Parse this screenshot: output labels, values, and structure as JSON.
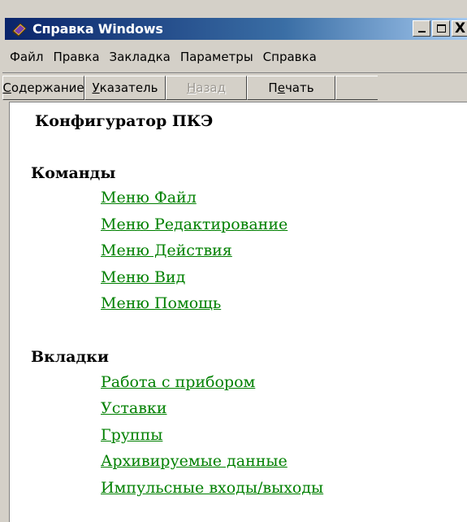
{
  "window": {
    "title": "Справка Windows",
    "icon": "help-book-icon",
    "buttons": {
      "minimize": "_",
      "maximize": "□",
      "close": "X"
    }
  },
  "menu": [
    "Файл",
    "Правка",
    "Закладка",
    "Параметры",
    "Справка"
  ],
  "toolbar": {
    "contents": {
      "accel": "С",
      "rest": "одержание"
    },
    "index": {
      "accel": "У",
      "rest": "казатель"
    },
    "back": {
      "accel": "Н",
      "rest": "азад",
      "disabled": true
    },
    "print": {
      "pre": "П",
      "accel": "е",
      "rest": "чать"
    }
  },
  "page": {
    "title": "Конфигуратор ПКЭ",
    "sections": [
      {
        "title": "Команды",
        "links": [
          "Меню Файл",
          "Меню Редактирование",
          "Меню Действия",
          "Меню Вид",
          "Меню Помощь"
        ]
      },
      {
        "title": "Вкладки",
        "links": [
          "Работа с прибором",
          "Уставки",
          "Группы",
          "Архивируемые данные",
          "Импульсные входы/выходы"
        ]
      }
    ]
  },
  "colors": {
    "link": "#008000",
    "titlebar_start": "#0a246a",
    "titlebar_end": "#a6caf0",
    "chrome": "#d4d0c8"
  }
}
